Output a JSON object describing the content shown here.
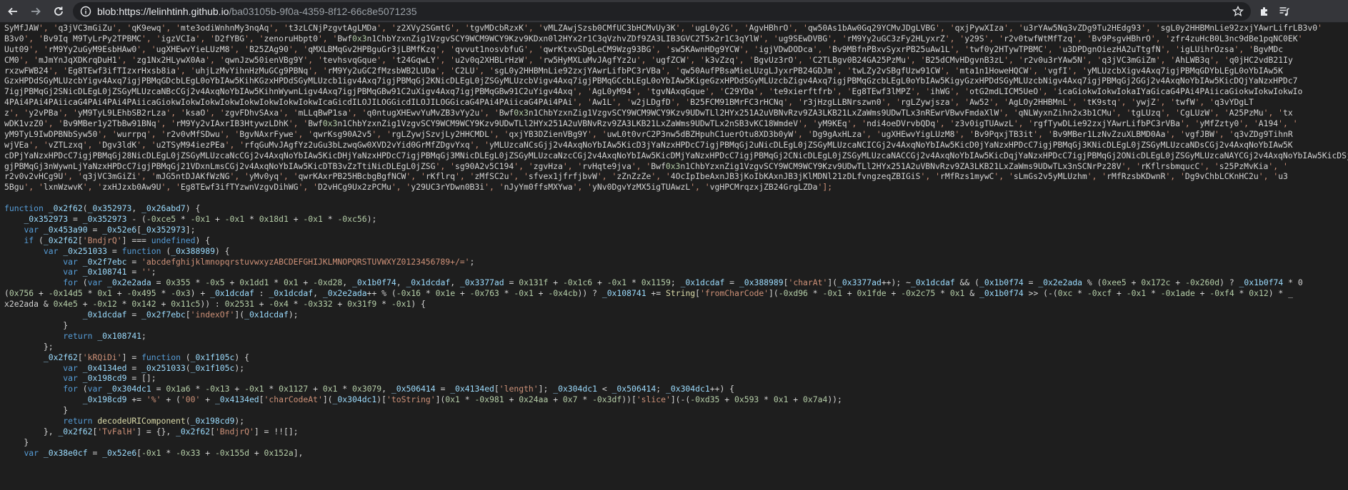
{
  "browser": {
    "url_host": "blob:https://lelinhtinh.github.io",
    "url_rest": "/ba03105b-9f0a-4359-8f12-66c8e5071235"
  },
  "code": {
    "lines": [
      "SyMfJAW', 'q3jVC3mGiZu', 'qK9ewq', 'mte3odiWnhnMy3nqAq', 't3zLCNjPzgvtAgLMDa', 'z2XVy2SGmtG', 'tgvMDcbRzxK', 'vMLZAwjSzsb0CMfUC3bHCMvUy3K', 'ugL0y2G', 'AgvHBhrO', 'qw50As1bAw0Gq29YCMvJDgLVBG', 'qxjPywXIza', 'u3rYAw5Nq3vZDg9Tu2HEdg93', 'sgL0y2HHBMnLie92zxjYAwrLifrLB3v0'",
      "B3v0', 'Bv9Iq M9TyLrPy2TPBMC', 'igzVCIa', 'D2fYBG', 'zenoruHbpt0', 'Bwf0x3n1ChbYzxnZig1VzgvSCY9WCM9WCY9Kzv9KDxn0l2HYx2r1C3qVzhvZDf9ZA3LIB3GVC2T5x2r1C3qYlW', 'ug9SEwDVBG', 'rM9Yy2uGC3zFy2HLyxrZ', 'y29S', 'r2v0twfWtMfTzq', 'Bv9PsgvHBhrO', 'zfr4zuHcB0L3nc9dBe1pqNC0EK'",
      "Uut09', 'rM9Yy2uGyM9EsbHAw0', 'ugXHEwvYieLUzM8', 'B25ZAg90', 'qMXLBMqGv2HPBguGr3jLBMfKzq', 'qvvut1nosvbfuG', 'qwrKtxvSDgLeCM9Wzg93BG', 'sw5KAwnHDg9YCW', 'igjVDwDODca', 'Bv9MBfnPBxvSyxrPB25uAw1L', 'twf0y2HTywTPBMC', 'u3DPDgnOiezHA2uTtgfN', 'igLUihrOzsa', 'BgvMDc",
      "CM0', 'mJmYnJqXDKrqDuH1', 'zg1Nx2HLywX0Aa', 'qwnJzw50ienVBg9Y', 'tevhsvqGque', 't24GqwLY', 'u2v0q2XHBLrHzW', 'rw5HyMXLuMvJAgfYz2u', 'ugfZCW', 'k3vZzq', 'BgvUz3rO', 'C2TLBgv0B24GA25PzMu', 'B25dCMvHDgvnB3zL', 'r2v0u3rYAw5N', 'q3jVC3mGiZm', 'AhLWB3q', 'q0jHC2vdB21Iy",
      "rxzwFWB24', 'Eg8TEwf3ifTIzxrHxsb8ia', 'uhjLzMvYihnHzMuGCg9PBNq', 'rM9Yy2uGC2fMzsbWB2LUDa', 'C2LU', 'sgL0y2HHBMnLie92zxjYAwrLifbPC3rVBa', 'qw50AufPBsaMieLUzgLJyxrPB24GDJm', 'twLZy2vSBgfUzw91CW', 'mta1n1HoweHQCW', 'vgfI', 'yMLUzcbXigv4Axq7igjPBMqGDYbLEgL0oYbIAw5K",
      "GzxHPDdSGyMLUzcbYigv4Axq7igjPBMqGDcbLEgL0oYbIAw5KihKGzxHPDdSGyMLUzcb1igv4Axq7igjPBMqGj2KNicDLEgL0jZSGyMLUzcbVigv4Axq7igjPBMqGCcbLEgL0oYbIAw5KigeGzxHPDdSGyMLUzcbZigv4Axq7igjPBMqGzcbLEgL0oYbIAw5KigyGzxHPDdSGyMLUzcbNigv4Axq7igjPBMqGj2GGj2v4AxqNoYbIAw5KicDQjYaNzxHPDc7",
      "7igjPBMqGj2SNicDLEgL0jZSGyMLUzcaNBcCGj2v4AxqNoYbIAw5KihnWywnLigv4Axq7igjPBMqGBw91C2uXigv4Axq7igjPBMqGBw91C2uYigv4Axq', 'AgL0yM94', 'tgvNAxqGque', 'C29YDa', 'te9xierftfrb', 'Eg8TEwf3lMPZ', 'ihWG', 'otG2mdLICM5UeO', 'icaGiokwIokwIokaIYaGicaG4PAi4PAiicaGiokwIokwIokwIo",
      "4PAi4PAi4PAiicaG4PAi4PAi4PAiicaGiokwIokwIokwIokwIokwIokwIokwIokwIcaGicdILOJILOGGicdILOJILOGGicaG4PAi4PAiicaG4PAi4PAi', 'Aw1L', 'w2jLDgfD', 'B25FCM91BMrFC3rHCNq', 'r3jHzgLLBNrszwn0', 'rgLZywjsza', 'Aw52', 'AgLOy2HHBMnL', 'tK9stq', 'ywjZ', 'twfW', 'q3vYDgLT",
      "z', 'y2vPBa', 'yM9TyL9LEhbSB2rLza', 'ksaO', 'zgvFDhvSAxa', 'mLLqBwP1sa', 'q0ntugXHEwvYuMvZB3vYy2u', 'Bwf0x3n1ChbYzxnZig1VzgvSCY9WCM9WCY9Kzv9UDwTLl2HYx251A2uVBNvRzv9ZA3LKB21LxZaWms9UDwTLx3nREwrVBwvFmdaXlW', 'qNLWyxnZihn2x3b1CMu', 'tgLUzq', 'CgLUzW', 'A25PzMu', 'tx",
      "wDK1vzZ0', 'Bv9MBer1y2TbBw91BNq', 'rM9Yy2vIAxrIB3HtywzLDhK', 'Bwf0x3n1ChbYzxnZig1VzgvSCY9WCM9WCY9Kzv9UDwTLl2HYx251A2uVBNvRzv9ZA3LKB21LxZaWms9UDwTLx2nSB3vKC18WmdeV', 'yM9KEq', 'ndi4oeDVrvbQDq', 'z3v0igTUAwzL', 'rgfTywDLie92zxjYAwrLifbPC3rVBa', 'yMfZzty0', 'A194', '",
      "yM9TyL9IwDPBNbSyw50', 'wurrpq', 'r2v0vMfSDwu', 'BgvNAxrFywe', 'qwrKsg90A2v5', 'rgLZywjSzvjLy2HHCMDL', 'qxjYB3DZienVBg9Y', 'uwL0t0vrC2P3nw5dBZHpuhC1uerOtu8XD3b0yW', 'Dg9gAxHLza', 'ugXHEwvYigLUzM8', 'Bv9PqxjTB3it', 'Bv9MBer1LzNvZzuXLBMD0Aa', 'vgfJBW', 'q3vZDg9TihnR",
      "wjVEa', 'vZTLzxq', 'Dgv3ldK', 'u2TSyM94iezPEa', 'rfqGuMvJAgfYz2uGu3bLzwqGw0XVD2vYid0GrMfZDgvYxq', 'yMLUzcaNCsGjj2v4AxqNoYbIAw5KicD3jYaNzxHPDcC7igjPBMqGj2uNicDLEgL0jZSGyMLUzcaNCICGj2v4AxqNoYbIAw5KicD0jYaNzxHPDcC7igjPBMqGj3KNicDLEgL0jZSGyMLUzcaNDsCGj2v4AxqNoYbIAw5K",
      "cDPjYaNzxHPDcC7igjPBMqGj28NicDLEgL0jZSGyMLUzcaNcCGj2v4AxqNoYbIAw5KicDHjYaNzxHPDcC7igjPBMqGj3MNicDLEgL0jZSGyMLUzcaNzcCGj2v4AxqNoYbIAw5KicDMjYaNzxHPDcC7igjPBMqGj2CNicDLEgL0jZSGyMLUzcaNACCGj2v4AxqNoYbIAw5KicDqjYaNzxHPDcC7igjPBMqGj2ONicDLEgL0jZSGyMLUzcaNAYCGj2v4AxqNoYbIAw5KicDSjYaNzxHPDc",
      "gjPBMqGj3nWywnLjYaNzxHPDcC7igjPBMqGj21VDxnLmsCGj2v4AxqNoYbIAw5KicDTB3vZzTtiNicDLEgL0jZSG', 'sg90A2v5C194', 'zgvHza', 'rvHqte9jva', 'Bwf0x3n1ChbYzxnZig1VzgvSCY9WCM9WCY9Kzv9UDwTLl2HYx251A2uVBNvRzv9ZA3LKB21LxZaWms9UDwTLx3nSCNrPz28V', 'rKflrsbmqucC', 's25PzMvKia', '",
      "r2v0v2vHCg9U', 'q3jVC3mGiZi', 'mJG5ntDJAKfWzNG', 'yMv0yq', 'qwrKAxrPB25HBcbgBgfNCW', 'rKflrq', 'zMfSC2u', 'sfvex1jfrfjbvW', 'zZnZzZe', '4OcIpIbeAxnJB3jKoIbKAxnJB3jKlMDNl21zDLfvngzeqZBIGiS', 'rMfRzs1mywC', 'sLmGs2v5yMLUzhm', 'rMfRzsbKDwnR', 'Dg9vChbLCKnHC2u', 'u3",
      "5Bgu', 'lxnWzwvK', 'zxHJzxb0Aw9U', 'Eg8TEwf3ifTYzwnVzgvDihWG', 'D2vHCg9Ux2zPCMu', 'y29UC3rYDwn0B3i', 'nJyYm0ffsMXYwa', 'yNv0DgvYzMX5igTUAwzL', 'vgHPCMrqzxjZB24GrgLZDa'];",
      "",
      "function _0x2f62(_0x352973, _0x26abd7) {",
      "    _0x352973 = _0x352973 - (-0xce5 * -0x1 + -0x1 * 0x18d1 + -0x1 * -0xc56);",
      "    var _0x453a90 = _0x52e6[_0x352973];",
      "    if (_0x2f62['BndjrQ'] === undefined) {",
      "        var _0x251033 = function (_0x388989) {",
      "            var _0x2f7ebc = 'abcdefghijklmnopqrstuvwxyzABCDEFGHIJKLMNOPQRSTUVWXYZ0123456789+/=';",
      "            var _0x108741 = '';",
      "            for (var _0x2e2ada = 0x355 * -0x5 + 0x1dd1 * 0x1 + -0xd28, _0x1b0f74, _0x1dcdaf, _0x3377ad = 0x131f + -0x1c6 + -0x1 * 0x1159; _0x1dcdaf = _0x388989['charAt'](_0x3377ad++); ~_0x1dcdaf && (_0x1b0f74 = _0x2e2ada % (0xee5 + 0x172c + -0x260d) ? _0x1b0f74 * 0",
      "(0x756 + -0x14d5 * 0x1 + -0x495 * -0x3) + _0x1dcdaf : _0x1dcdaf, _0x2e2ada++ % (-0x16 * 0x1e + -0x763 * -0x1 + -0x4cb)) ? _0x108741 += String['fromCharCode'](-0xd96 * -0x1 + 0x1fde + -0x2c75 * 0x1 & _0x1b0f74 >> (-(0xc * -0xcf + -0x1 * -0x1ade + -0xf4 * 0x12) * _",
      "x2e2ada & 0x4e5 + -0x12 * 0x142 + 0x11c5)) : 0x2531 + -0x4 * -0x332 + 0x31f9 * -0x1) {",
      "                _0x1dcdaf = _0x2f7ebc['indexOf'](_0x1dcdaf);",
      "            }",
      "            return _0x108741;",
      "        };",
      "        _0x2f62['kRQiDi'] = function (_0x1f105c) {",
      "            var _0x4134ed = _0x251033(_0x1f105c);",
      "            var _0x198cd9 = [];",
      "            for (var _0x304dc1 = 0x1a6 * -0x13 + -0x1 * 0x1127 + 0x1 * 0x3079, _0x506414 = _0x4134ed['length']; _0x304dc1 < _0x506414; _0x304dc1++) {",
      "                _0x198cd9 += '%' + ('00' + _0x4134ed['charCodeAt'](_0x304dc1)['toString'](0x1 * -0x981 + 0x24aa + 0x7 * -0x3df))['slice'](-(-0xd35 + 0x593 * 0x1 + 0x7a4));",
      "            }",
      "            return decodeURIComponent(_0x198cd9);",
      "        }, _0x2f62['TvFalH'] = {}, _0x2f62['BndjrQ'] = !![];",
      "    }",
      "    var _0x38e0cf = _0x52e6[-0x1 * -0x33 + -0x155d + 0x152a],"
    ]
  }
}
